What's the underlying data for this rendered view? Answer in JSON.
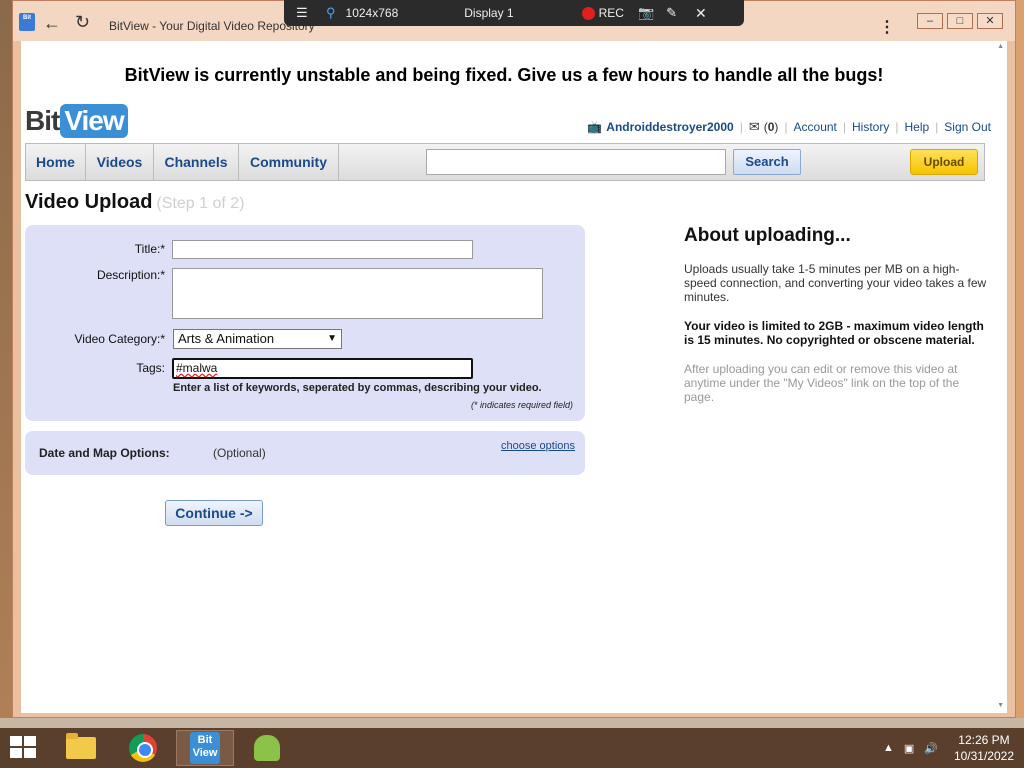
{
  "window": {
    "title": "BitView - Your Digital Video Repository",
    "app_icon_text": "Bit"
  },
  "remote_bar": {
    "resolution": "1024x768",
    "display": "Display 1",
    "rec_label": "REC"
  },
  "banner": "BitView is currently unstable and being fixed. Give us a few hours to handle all the bugs!",
  "logo": {
    "bit": "Bit",
    "view": "View"
  },
  "userbar": {
    "username": "Androiddestroyer2000",
    "mail_open": "(",
    "mail_count": "0",
    "mail_close": ")",
    "links": [
      "Account",
      "History",
      "Help",
      "Sign Out"
    ]
  },
  "nav": {
    "tabs": [
      "Home",
      "Videos",
      "Channels",
      "Community"
    ],
    "search_value": "",
    "search_button": "Search",
    "upload_button": "Upload"
  },
  "page": {
    "title": "Video Upload",
    "step": "(Step 1 of 2)"
  },
  "form": {
    "title_label": "Title:*",
    "title_value": "",
    "description_label": "Description:*",
    "description_value": "",
    "category_label": "Video Category:*",
    "category_value": "Arts & Animation",
    "tags_label": "Tags:",
    "tags_value": "#malwa",
    "tags_hint": "Enter a list of keywords, seperated by commas, describing your video.",
    "required_note": "(* indicates required field)"
  },
  "date_map": {
    "label": "Date and Map Options:",
    "optional": "(Optional)",
    "link": "choose options"
  },
  "continue_button": "Continue ->",
  "about": {
    "title": "About uploading...",
    "p1": "Uploads usually take 1-5 minutes per MB on a high-speed connection, and converting your video takes a few minutes.",
    "p2": "Your video is limited to 2GB - maximum video length is 15 minutes. No copyrighted or obscene material.",
    "p3": "After uploading you can edit or remove this video at anytime under the \"My Videos\" link on the top of the page."
  },
  "taskbar": {
    "bitview_icon_top": "Bit",
    "bitview_icon_bottom": "View",
    "time": "12:26 PM",
    "date": "10/31/2022"
  },
  "colors": {
    "nav_link": "#1a4a8a",
    "form_panel": "#dde0f6",
    "upload_button": "#f5c400",
    "logo_view": "#3a8fd6"
  }
}
